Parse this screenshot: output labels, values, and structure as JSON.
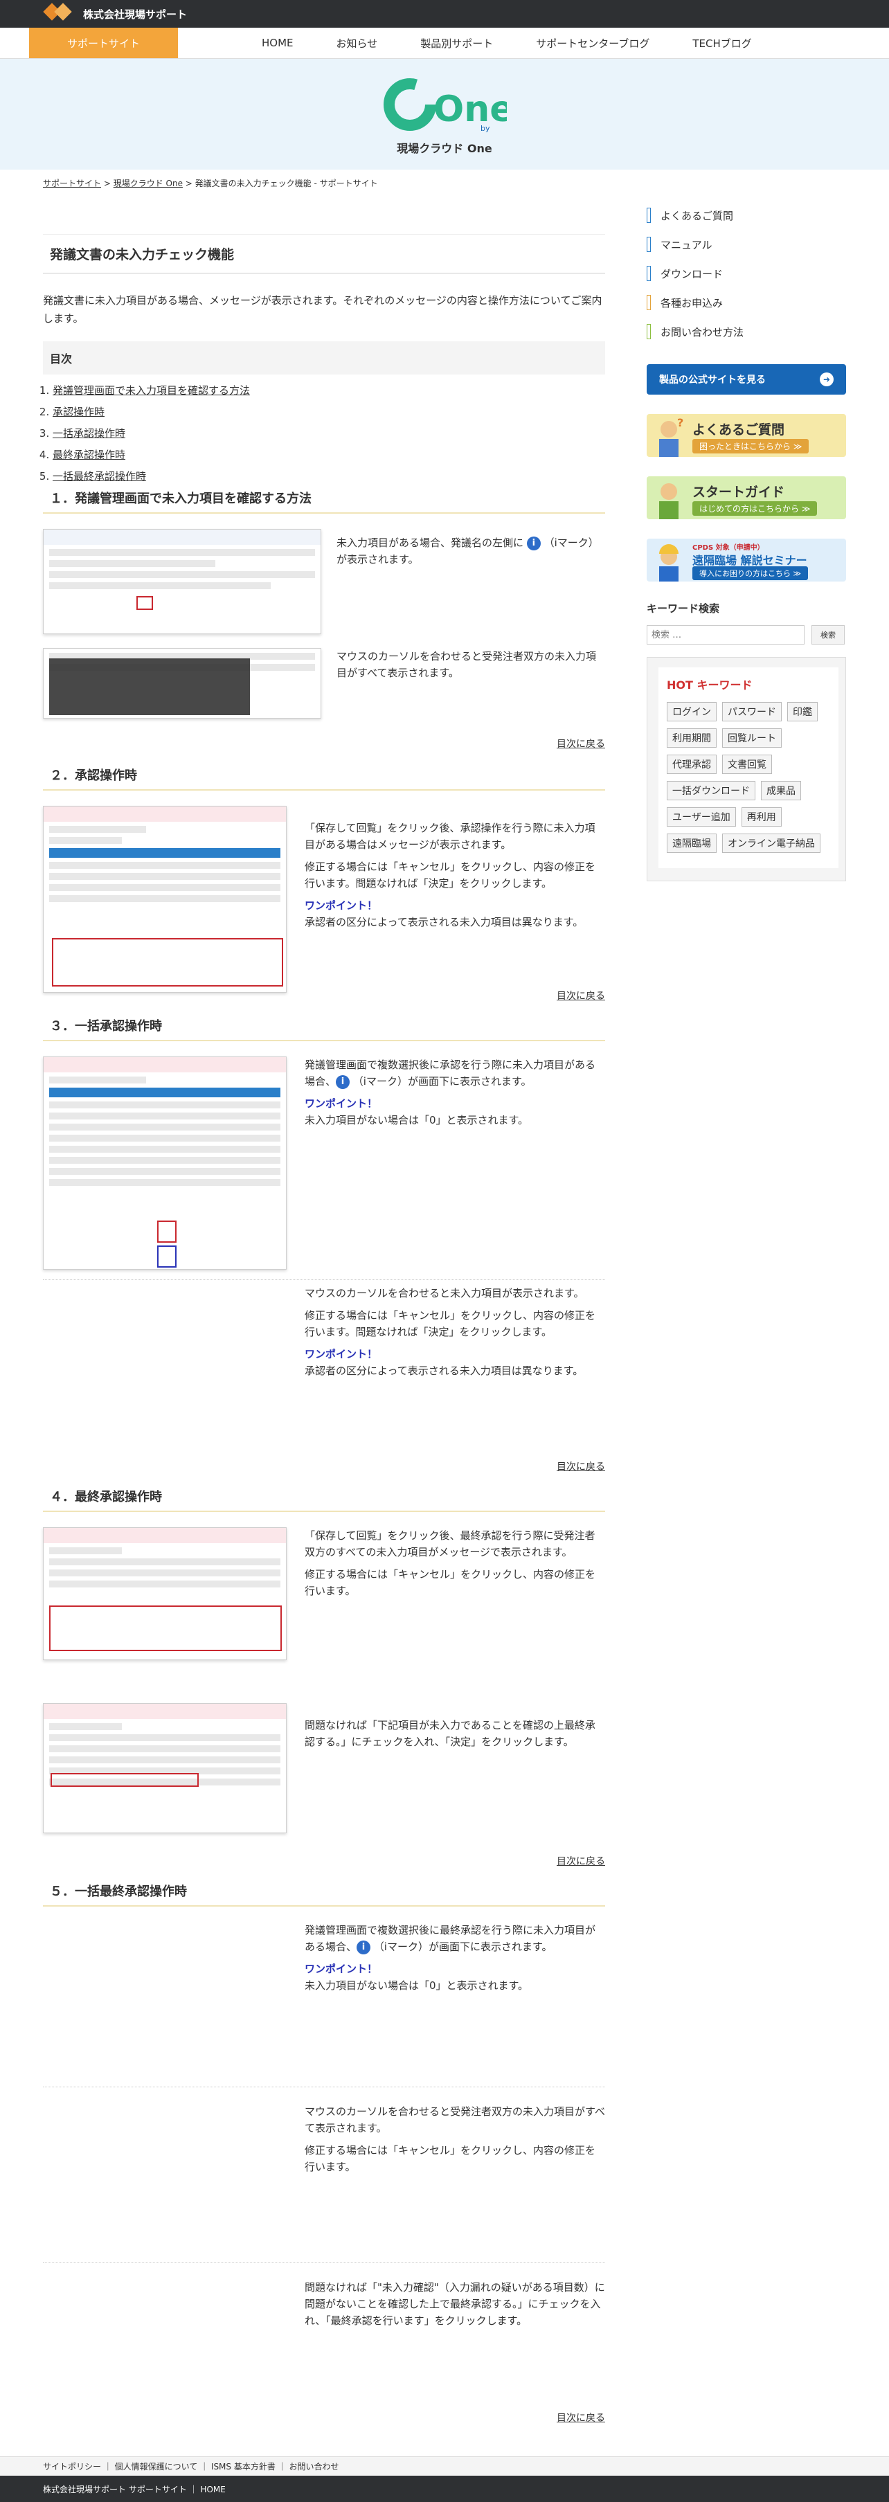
{
  "header": {
    "company": "株式会社現場サポート"
  },
  "nav": {
    "support": "サポートサイト",
    "items": [
      "HOME",
      "お知らせ",
      "製品別サポート",
      "サポートセンターブログ",
      "TECHブログ"
    ]
  },
  "hero": {
    "logo_text": "One",
    "logo_sub": "by",
    "title": "現場クラウド One"
  },
  "breadcrumb": {
    "home": "サポートサイト",
    "sep": " > ",
    "product": "現場クラウド One",
    "current": " > 発議文書の未入力チェック機能 - サポートサイト"
  },
  "main": {
    "title": "発議文書の未入力チェック機能",
    "intro": "発議文書に未入力項目がある場合、メッセージが表示されます。それぞれのメッセージの内容と操作方法についてご案内します。",
    "toc_title": "目次",
    "toc": [
      "発議管理画面で未入力項目を確認する方法",
      "承認操作時",
      "一括承認操作時",
      "最終承認操作時",
      "一括最終承認操作時"
    ],
    "back": "目次に戻る",
    "onepoint": "ワンポイント！",
    "icon_suffix": "（iマーク）",
    "s1": {
      "title": "１．発議管理画面で未入力項目を確認する方法",
      "t1a": "未入力項目がある場合、発議名の左側に",
      "t1b": "（iマーク）が表示されます。",
      "t2": "マウスのカーソルを合わせると受発注者双方の未入力項目がすべて表示されます。"
    },
    "s2": {
      "title": "２．承認操作時",
      "p1": "「保存して回覧」をクリック後、承認操作を行う際に未入力項目がある場合はメッセージが表示されます。",
      "p2": "修正する場合には「キャンセル」をクリックし、内容の修正を行います。問題なければ「決定」をクリックします。",
      "p3": "承認者の区分によって表示される未入力項目は異なります。"
    },
    "s3": {
      "title": "３．一括承認操作時",
      "p1a": "発議管理画面で複数選択後に承認を行う際に未入力項目がある場合、",
      "p1b": "が画面下に表示されます。",
      "p2": "未入力項目がない場合は「0」と表示されます。",
      "p3": "マウスのカーソルを合わせると未入力項目が表示されます。",
      "p4": "修正する場合には「キャンセル」をクリックし、内容の修正を行います。問題なければ「決定」をクリックします。",
      "p5": "承認者の区分によって表示される未入力項目は異なります。"
    },
    "s4": {
      "title": "４．最終承認操作時",
      "p1": "「保存して回覧」をクリック後、最終承認を行う際に受発注者双方のすべての未入力項目がメッセージで表示されます。",
      "p2": "修正する場合には「キャンセル」をクリックし、内容の修正を行います。",
      "p3": "問題なければ「下記項目が未入力であることを確認の上最終承認する。」にチェックを入れ、「決定」をクリックします。"
    },
    "s5": {
      "title": "５．一括最終承認操作時",
      "p1a": "発議管理画面で複数選択後に最終承認を行う際に未入力項目がある場合、",
      "p1b": "が画面下に表示されます。",
      "p2": "未入力項目がない場合は「0」と表示されます。",
      "p3": "マウスのカーソルを合わせると受発注者双方の未入力項目がすべて表示されます。",
      "p4": "修正する場合には「キャンセル」をクリックし、内容の修正を行います。",
      "p5": "問題なければ「\"未入力確認\"（入力漏れの疑いがある項目数）に問題がないことを確認した上で最終承認する。」にチェックを入れ、「最終承認を行います」をクリックします。"
    }
  },
  "sidebar": {
    "links": [
      {
        "label": "よくあるご質問",
        "color": "#2a7fc9"
      },
      {
        "label": "マニュアル",
        "color": "#2a7fc9"
      },
      {
        "label": "ダウンロード",
        "color": "#2a7fc9"
      },
      {
        "label": "各種お申込み",
        "color": "#e3a33a"
      },
      {
        "label": "お問い合わせ方法",
        "color": "#8cbf3f"
      }
    ],
    "official_btn": "製品の公式サイトを見る",
    "banner1": {
      "title": "よくあるご質問",
      "sub": "困ったときはこちらから ≫"
    },
    "banner2": {
      "title": "スタートガイド",
      "sub": "はじめての方はこちらから ≫"
    },
    "banner3": {
      "tag": "CPDS 対象（申請中）",
      "title": "遠隔臨場 解説セミナー",
      "sub": "導入にお困りの方はこちら ≫"
    },
    "keyword_label": "キーワード検索",
    "search_placeholder": "検索 …",
    "search_btn": "検索",
    "hot_title": "HOT キーワード",
    "hot": [
      "ログイン",
      "パスワード",
      "印鑑",
      "利用期間",
      "回覧ルート",
      "代理承認",
      "文書回覧",
      "一括ダウンロード",
      "成果品",
      "ユーザー追加",
      "再利用",
      "遠隔臨場",
      "オンライン電子納品"
    ]
  },
  "footer": {
    "links": "サイトポリシー ｜ 個人情報保護について ｜ ISMS 基本方針書 ｜ お問い合わせ",
    "copy": "株式会社現場サポート サポートサイト ｜ HOME"
  },
  "colors": {
    "accent": "#f3a53b",
    "brand_blue": "#1867b6",
    "onepoint": "#2a33b6",
    "logo_green": "#2bb58a"
  }
}
